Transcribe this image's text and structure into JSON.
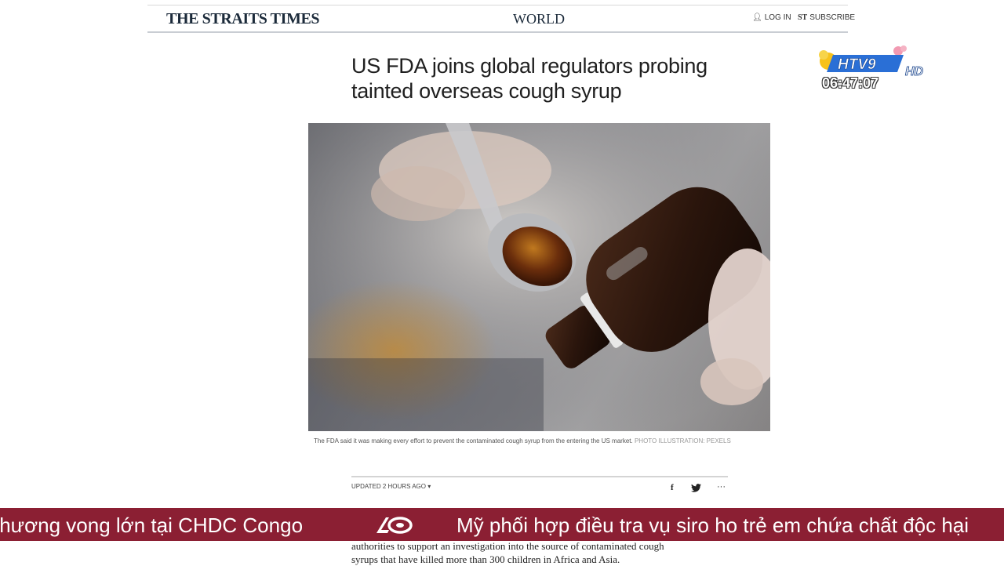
{
  "header": {
    "logo": "THE STRAITS TIMES",
    "section": "WORLD",
    "login_label": "LOG IN",
    "subscribe_label": "SUBSCRIBE",
    "subscribe_icon_text": "ST"
  },
  "article": {
    "headline_line1": "US FDA joins global regulators probing",
    "headline_line2": "tainted overseas cough syrup",
    "caption": "The FDA said it was making every effort to prevent the contaminated cough syrup from the entering the US market.",
    "caption_credit": "PHOTO ILLUSTRATION: PEXELS",
    "updated": "UPDATED 2 HOURS AGO",
    "body_line1": "authorities to support an investigation into the source of contaminated cough",
    "body_line2": "syrups that have killed more than 300 children in Africa and Asia."
  },
  "share": {
    "facebook": "f",
    "more": "···"
  },
  "broadcast": {
    "channel": "HTV9",
    "hd": "HD",
    "time": "06:47:07",
    "ticker_left": "thương vong lớn tại CHDC Congo",
    "ticker_right": "Mỹ phối hợp điều tra vụ siro ho trẻ em chứa chất độc hại",
    "colors": {
      "ticker_bg": "#8b1f33",
      "logo_blue": "#2a6fd6",
      "logo_yellow": "#f7c21b"
    }
  }
}
